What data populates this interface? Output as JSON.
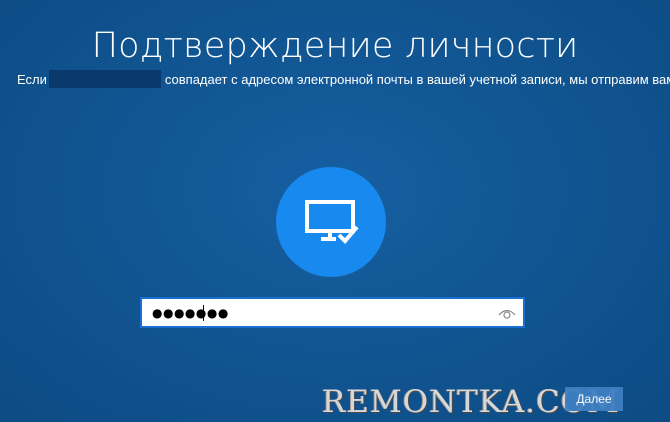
{
  "header": {
    "title": "Подтверждение личности",
    "subtitle_before": "Если",
    "subtitle_after": "совпадает с адресом электронной почты в вашей учетной записи, мы отправим вам код."
  },
  "verify": {
    "icon": "monitor-check-icon",
    "circle_color": "#1889ee"
  },
  "password": {
    "value": "●●●●●●●",
    "reveal_icon": "eye-icon"
  },
  "footer": {
    "watermark": "REMONTKA.COM",
    "next_label": "Далее"
  },
  "colors": {
    "background": "#105490",
    "accent": "#1b6fd0"
  }
}
